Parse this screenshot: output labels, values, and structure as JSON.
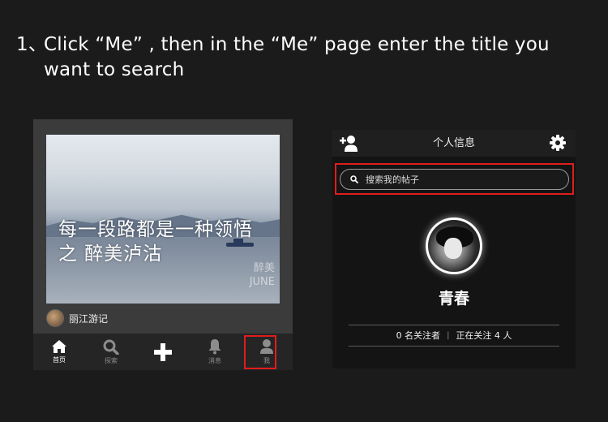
{
  "instruction": {
    "number": "1、",
    "text_line1": "Click “Me” , then in the “Me” page enter the title you",
    "text_line2": "want to search"
  },
  "left_screen": {
    "photo_caption_line1": "每一段路都是一种领悟",
    "photo_caption_line2": "之 醉美泸沽",
    "watermark_line1": "醉美",
    "watermark_line2": "JUNE",
    "post_author": "丽江游记",
    "tabs": [
      {
        "label": "首页",
        "icon": "home-icon"
      },
      {
        "label": "探索",
        "icon": "search-icon"
      },
      {
        "label": "",
        "icon": "plus-icon"
      },
      {
        "label": "消息",
        "icon": "bell-icon"
      },
      {
        "label": "我",
        "icon": "user-icon"
      }
    ]
  },
  "right_screen": {
    "header_title": "个人信息",
    "search_placeholder": "搜索我的帖子",
    "username": "青春",
    "followers": "0 名关注者",
    "separator": "|",
    "following": "正在关注 4 人"
  },
  "colors": {
    "background": "#1b1b1b",
    "highlight": "#e01d1d"
  }
}
